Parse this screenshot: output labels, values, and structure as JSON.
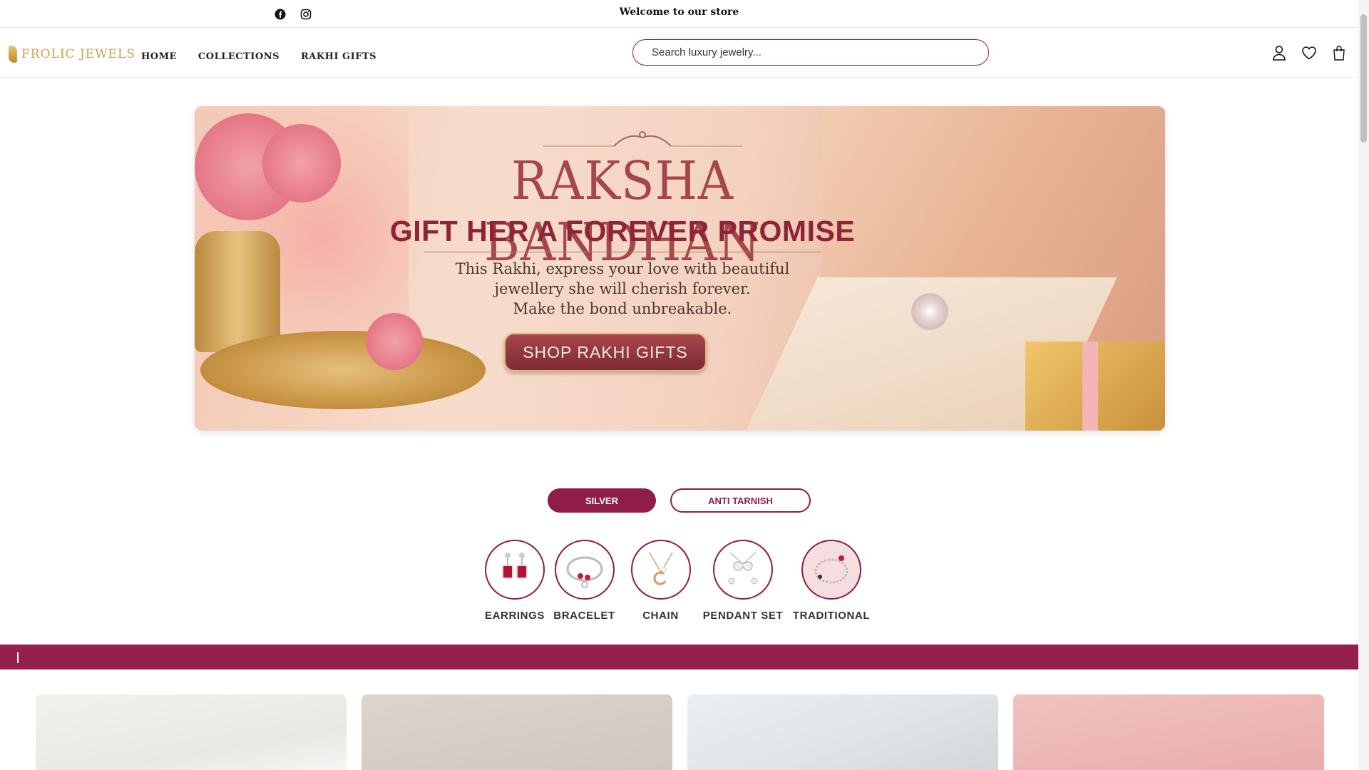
{
  "topbar": {
    "social_icons": [
      "facebook-icon",
      "instagram-icon"
    ],
    "welcome_text": "Welcome to our store"
  },
  "header": {
    "logo_text": "FROLIC JEWELS",
    "nav": [
      {
        "label": "HOME"
      },
      {
        "label": "COLLECTIONS"
      },
      {
        "label": "RAKHI GIFTS"
      }
    ],
    "search": {
      "placeholder": "Search luxury jewelry..."
    },
    "icons": [
      "user-icon",
      "heart-icon",
      "bag-icon"
    ]
  },
  "hero": {
    "title": "RAKSHA BANDHAN",
    "subtitle": "GIFT HER A FOREVER PROMISE",
    "desc_lines": [
      "This Rakhi, express your love with beautiful",
      "jewellery she will cherish forever.",
      "Make the bond unbreakable."
    ],
    "cta": "SHOP RAKHI GIFTS"
  },
  "tabs": [
    {
      "label": "SILVER",
      "active": true
    },
    {
      "label": "ANTI TARNISH",
      "active": false
    }
  ],
  "categories": [
    {
      "label": "EARRINGS"
    },
    {
      "label": "BRACELET"
    },
    {
      "label": "CHAIN"
    },
    {
      "label": "PENDANT SET"
    },
    {
      "label": "TRADITIONAL"
    }
  ],
  "colors": {
    "brand": "#8f1c49",
    "strip": "#95204d",
    "gold": "#c9a04a"
  }
}
